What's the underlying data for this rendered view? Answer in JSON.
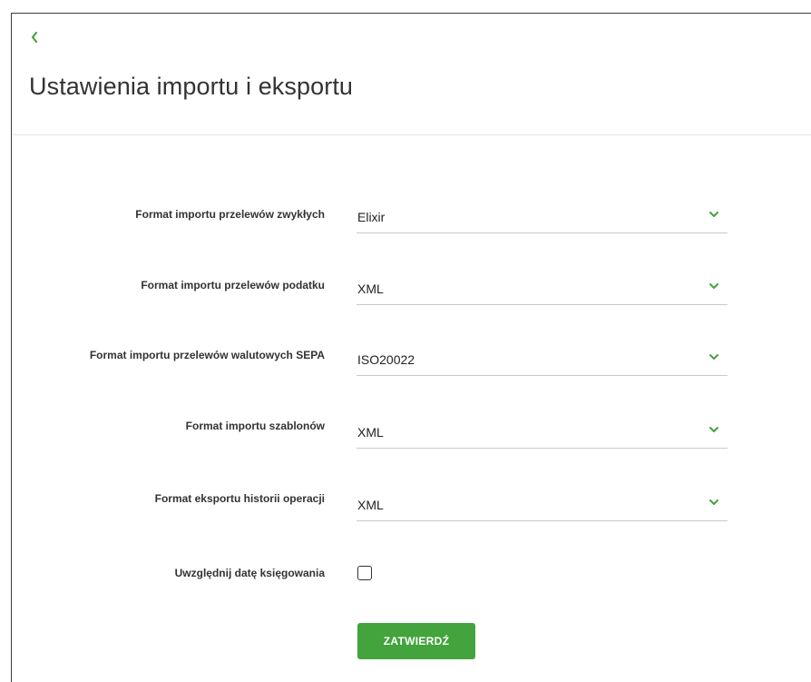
{
  "page": {
    "title": "Ustawienia importu i eksportu",
    "back_icon": "chevron-left-icon"
  },
  "form": {
    "fields": [
      {
        "label": "Format importu przelewów zwykłych",
        "value": "Elixir"
      },
      {
        "label": "Format importu przelewów podatku",
        "value": "XML"
      },
      {
        "label": "Format importu przelewów walutowych SEPA",
        "value": "ISO20022"
      },
      {
        "label": "Format importu szablonów",
        "value": "XML"
      },
      {
        "label": "Format eksportu historii operacji",
        "value": "XML"
      }
    ],
    "checkbox": {
      "label": "Uwzględnij datę księgowania",
      "checked": false
    },
    "submit_label": "ZATWIERDŹ"
  },
  "colors": {
    "accent": "#43a33d",
    "text": "#333333",
    "divider": "#e3e3e3"
  }
}
